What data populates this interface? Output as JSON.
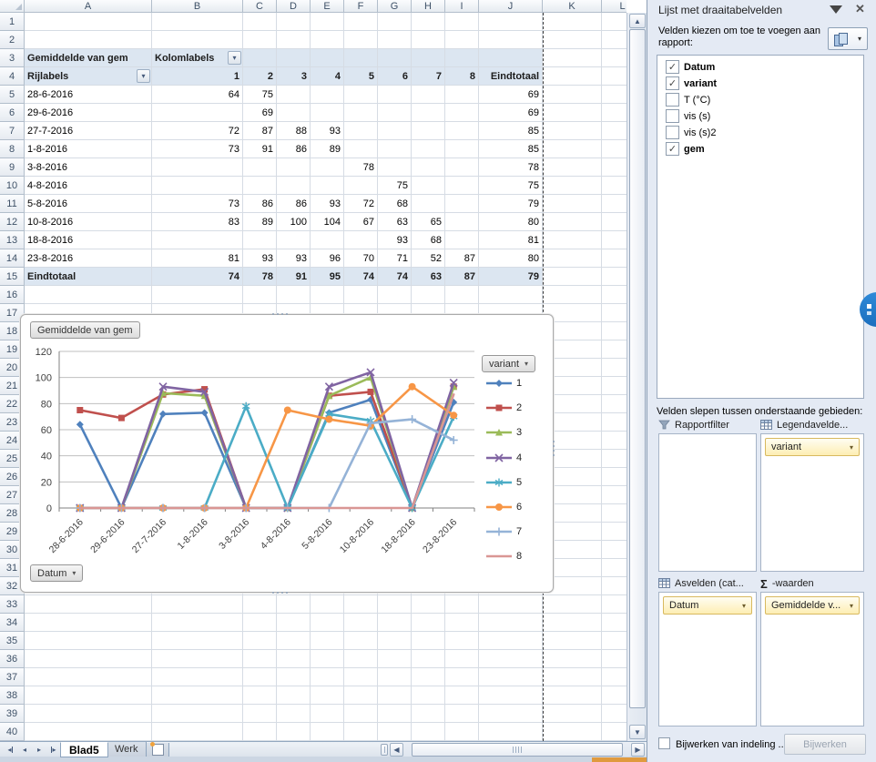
{
  "grid": {
    "col_letters": [
      "A",
      "B",
      "C",
      "D",
      "E",
      "F",
      "G",
      "H",
      "I",
      "J",
      "K",
      "L"
    ],
    "row_count": 40
  },
  "pivot": {
    "header_fill": "#dce6f1",
    "measure_label": "Gemiddelde van gem",
    "col_labels_label": "Kolomlabels",
    "row_labels_label": "Rijlabels",
    "col_keys": [
      "1",
      "2",
      "3",
      "4",
      "5",
      "6",
      "7",
      "8"
    ],
    "grand_total_label": "Eindtotaal",
    "rows": [
      {
        "date": "28-6-2016",
        "values": [
          "64",
          "75",
          "",
          "",
          "",
          "",
          "",
          "",
          "69"
        ]
      },
      {
        "date": "29-6-2016",
        "values": [
          "",
          "69",
          "",
          "",
          "",
          "",
          "",
          "",
          "69"
        ]
      },
      {
        "date": "27-7-2016",
        "values": [
          "72",
          "87",
          "88",
          "93",
          "",
          "",
          "",
          "",
          "85"
        ]
      },
      {
        "date": "1-8-2016",
        "values": [
          "73",
          "91",
          "86",
          "89",
          "",
          "",
          "",
          "",
          "85"
        ]
      },
      {
        "date": "3-8-2016",
        "values": [
          "",
          "",
          "",
          "",
          "78",
          "",
          "",
          "",
          "78"
        ]
      },
      {
        "date": "4-8-2016",
        "values": [
          "",
          "",
          "",
          "",
          "",
          "75",
          "",
          "",
          "75"
        ]
      },
      {
        "date": "5-8-2016",
        "values": [
          "73",
          "86",
          "86",
          "93",
          "72",
          "68",
          "",
          "",
          "79"
        ]
      },
      {
        "date": "10-8-2016",
        "values": [
          "83",
          "89",
          "100",
          "104",
          "67",
          "63",
          "65",
          "",
          "80"
        ]
      },
      {
        "date": "18-8-2016",
        "values": [
          "",
          "",
          "",
          "",
          "",
          "93",
          "68",
          "",
          "81"
        ]
      },
      {
        "date": "23-8-2016",
        "values": [
          "81",
          "93",
          "93",
          "96",
          "70",
          "71",
          "52",
          "87",
          "80"
        ]
      }
    ],
    "total_row": {
      "label": "Eindtotaal",
      "values": [
        "74",
        "78",
        "91",
        "95",
        "74",
        "74",
        "63",
        "87",
        "79"
      ]
    }
  },
  "chart_data": {
    "type": "line",
    "title_button": "Gemiddelde van gem",
    "axis_button": "Datum",
    "legend_button": "variant",
    "categories": [
      "28-6-2016",
      "29-6-2016",
      "27-7-2016",
      "1-8-2016",
      "3-8-2016",
      "4-8-2016",
      "5-8-2016",
      "10-8-2016",
      "18-8-2016",
      "23-8-2016"
    ],
    "ylim": [
      0,
      120
    ],
    "ytick": 20,
    "grid": true,
    "legend_position": "right",
    "series": [
      {
        "name": "1",
        "color": "#4F81BD",
        "marker": "diamond",
        "values": [
          64,
          0,
          72,
          73,
          0,
          0,
          73,
          83,
          0,
          81
        ]
      },
      {
        "name": "2",
        "color": "#C0504D",
        "marker": "square",
        "values": [
          75,
          69,
          87,
          91,
          0,
          0,
          86,
          89,
          0,
          93
        ]
      },
      {
        "name": "3",
        "color": "#9BBB59",
        "marker": "triangle",
        "values": [
          0,
          0,
          88,
          86,
          0,
          0,
          86,
          100,
          0,
          93
        ]
      },
      {
        "name": "4",
        "color": "#8064A2",
        "marker": "x",
        "values": [
          0,
          0,
          93,
          89,
          0,
          0,
          93,
          104,
          0,
          96
        ]
      },
      {
        "name": "5",
        "color": "#4BACC6",
        "marker": "asterisk",
        "values": [
          0,
          0,
          0,
          0,
          78,
          0,
          72,
          67,
          0,
          70
        ]
      },
      {
        "name": "6",
        "color": "#F79646",
        "marker": "circle",
        "values": [
          0,
          0,
          0,
          0,
          0,
          75,
          68,
          63,
          93,
          71
        ]
      },
      {
        "name": "7",
        "color": "#95B3D7",
        "marker": "plus",
        "values": [
          0,
          0,
          0,
          0,
          0,
          0,
          0,
          65,
          68,
          52
        ]
      },
      {
        "name": "8",
        "color": "#D99694",
        "marker": "none",
        "values": [
          0,
          0,
          0,
          0,
          0,
          0,
          0,
          0,
          0,
          87
        ]
      }
    ]
  },
  "panel": {
    "title": "Lijst met draaitabelvelden",
    "intro": "Velden kiezen om toe te voegen aan rapport:",
    "fields": [
      {
        "label": "Datum",
        "checked": true,
        "bold": true
      },
      {
        "label": "variant",
        "checked": true,
        "bold": true
      },
      {
        "label": "T (°C)",
        "checked": false,
        "bold": false
      },
      {
        "label": "vis (s)",
        "checked": false,
        "bold": false
      },
      {
        "label": "vis (s)2",
        "checked": false,
        "bold": false
      },
      {
        "label": "gem",
        "checked": true,
        "bold": true
      }
    ],
    "drag_hint": "Velden slepen tussen onderstaande gebieden:",
    "zones": [
      {
        "label": "Rapportfilter",
        "icon": "funnel",
        "items": []
      },
      {
        "label": "Legendavelde...",
        "icon": "table",
        "items": [
          "variant"
        ]
      },
      {
        "label": "Asvelden (cat...",
        "icon": "table",
        "items": [
          "Datum"
        ]
      },
      {
        "label": "-waarden",
        "icon": "sigma",
        "items": [
          "Gemiddelde v..."
        ]
      }
    ],
    "defer_label": "Bijwerken van indeling ...",
    "update_button": "Bijwerken"
  },
  "sheet_tabs": {
    "tabs": [
      {
        "label": "Blad5",
        "active": true
      },
      {
        "label": "Werk",
        "active": false
      }
    ]
  }
}
